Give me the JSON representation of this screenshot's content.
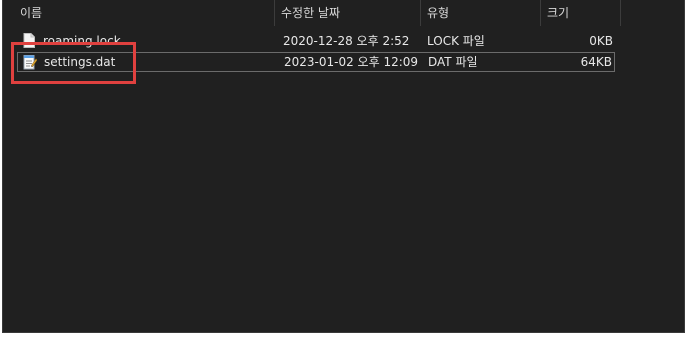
{
  "columns": {
    "name": "이름",
    "date": "수정한 날짜",
    "type": "유형",
    "size": "크기"
  },
  "files": [
    {
      "name": "roaming.lock",
      "date": "2020-12-28 오후 2:52",
      "type": "LOCK 파일",
      "size": "0KB",
      "icon": "blank-file-icon"
    },
    {
      "name": "settings.dat",
      "date": "2023-01-02 오후 12:09",
      "type": "DAT 파일",
      "size": "64KB",
      "icon": "notepad-file-icon",
      "selected": true
    }
  ],
  "colors": {
    "background": "#202020",
    "highlight_annotation": "#e0413f",
    "text": "#e8e8e8"
  }
}
